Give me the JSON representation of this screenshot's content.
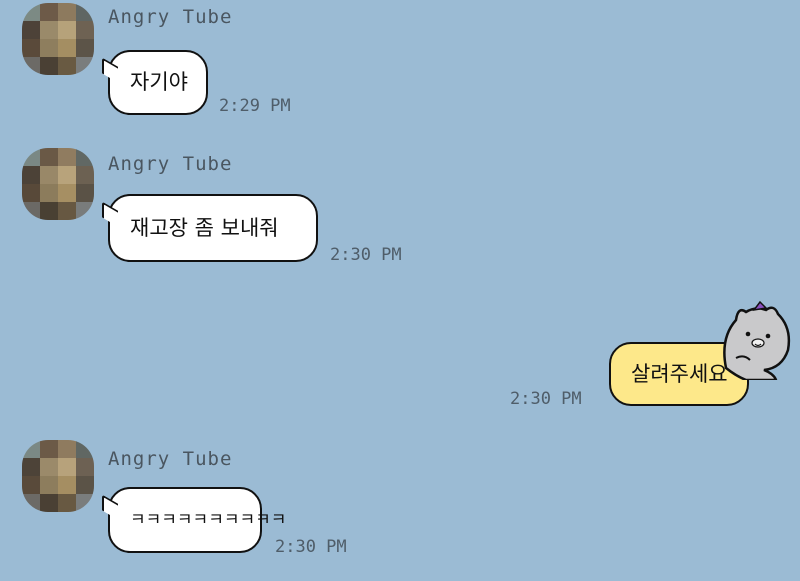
{
  "chat": {
    "messages": [
      {
        "sender": "Angry Tube",
        "text": "자기야",
        "time": "2:29 PM",
        "side": "left"
      },
      {
        "sender": "Angry Tube",
        "text": "재고장 좀 보내줘",
        "time": "2:30 PM",
        "side": "left"
      },
      {
        "sender": "",
        "text": "살려주세요",
        "time": "2:30 PM",
        "side": "right"
      },
      {
        "sender": "Angry Tube",
        "text": "ㅋㅋㅋㅋㅋㅋㅋㅋㅋㅋ",
        "time": "2:30 PM",
        "side": "left"
      }
    ]
  },
  "colors": {
    "background": "#9bbbd4",
    "incoming_bubble": "#ffffff",
    "outgoing_bubble": "#fde88a",
    "bubble_border": "#111111",
    "timestamp": "#4f5d69"
  },
  "icons": {
    "avatar": "pixelated-avatar-icon",
    "sticker": "grey-cat-sticker-icon"
  }
}
